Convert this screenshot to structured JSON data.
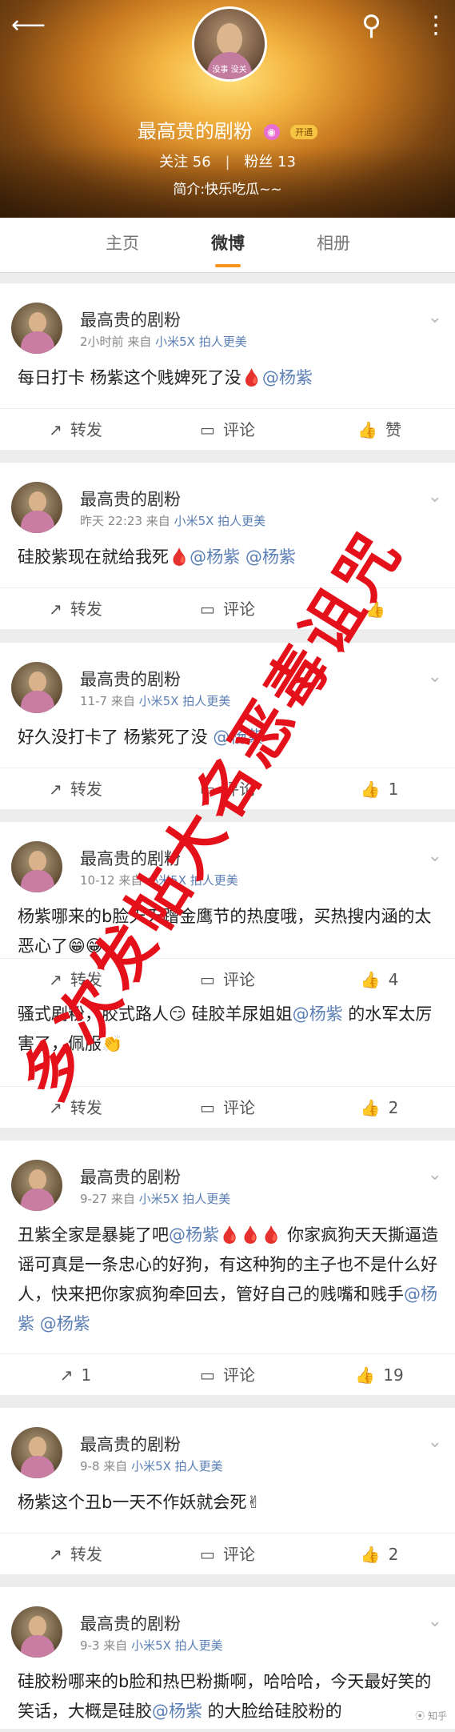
{
  "header": {
    "back_glyph": "⟵",
    "search_glyph": "⚲",
    "more_glyph": "⋮",
    "avatar_caption": "没事 没关",
    "username": "最高贵的剧粉",
    "open_badge": "开通",
    "following": "关注 56",
    "followers": "粉丝 13",
    "bio": "简介:快乐吃瓜~~"
  },
  "tabs": [
    "主页",
    "微博",
    "相册"
  ],
  "active_tab": "微博",
  "watermark": "多次发帖大名恶毒诅咒",
  "posts": [
    {
      "name": "最高贵的剧粉",
      "time": "2小时前",
      "src_prefix": "来自",
      "device": "小米5X 拍人更美",
      "text_html": "每日打卡 杨紫这个贱婢死了没🩸<span class=\"at\">@杨紫</span>",
      "repost": "转发",
      "comment": "评论",
      "like": "赞"
    },
    {
      "name": "最高贵的剧粉",
      "time": "昨天 22:23",
      "src_prefix": "来自",
      "device": "小米5X 拍人更美",
      "text_html": "硅胶紫现在就给我死🩸<span class=\"at\">@杨紫</span> <span class=\"at\">@杨紫</span>",
      "repost": "转发",
      "comment": "评论",
      "like": ""
    },
    {
      "name": "最高贵的剧粉",
      "time": "11-7",
      "src_prefix": "来自",
      "device": "小米5X 拍人更美",
      "text_html": "好久没打卡了 杨紫死了没 <span class=\"at\">@杨紫</span>",
      "repost": "转发",
      "comment": "评论",
      "like": "1"
    },
    {
      "name": "最高贵的剧粉",
      "time": "10-12",
      "src_prefix": "来自",
      "device": "小米5X 拍人更美",
      "text_html": "杨紫哪来的b脸天天蹭金鹰节的热度哦，买热搜内涵的太恶心了😁😁",
      "repost": "转发",
      "comment": "评论",
      "like": "4"
    },
    {
      "name": "",
      "time": "",
      "src_prefix": "",
      "device": "",
      "text_html": "骚式剧粉，胶式路人😏 硅胶羊尿姐姐<span class=\"at\">@杨紫</span> 的水军太厉害了，佩服👏",
      "repost": "转发",
      "comment": "评论",
      "like": "2"
    },
    {
      "name": "最高贵的剧粉",
      "time": "9-27",
      "src_prefix": "来自",
      "device": "小米5X 拍人更美",
      "text_html": "丑紫全家是暴毙了吧<span class=\"at\">@杨紫</span>🩸🩸🩸 你家疯狗天天撕逼造谣可真是一条忠心的好狗，有这种狗的主子也不是什么好人，快来把你家疯狗牵回去，管好自己的贱嘴和贱手<span class=\"at\">@杨紫</span> <span class=\"at\">@杨紫</span>",
      "repost": "1",
      "comment": "评论",
      "like": "19"
    },
    {
      "name": "最高贵的剧粉",
      "time": "9-8",
      "src_prefix": "来自",
      "device": "小米5X 拍人更美",
      "text_html": "杨紫这个丑b一天不作妖就会死✌",
      "repost": "转发",
      "comment": "评论",
      "like": "2"
    },
    {
      "name": "最高贵的剧粉",
      "time": "9-3",
      "src_prefix": "来自",
      "device": "小米5X 拍人更美",
      "text_html": "硅胶粉哪来的b脸和热巴粉撕啊，哈哈哈，今天最好笑的笑话，大概是硅胶<span class=\"at\">@杨紫</span> 的大脸给硅胶粉的",
      "repost": "",
      "comment": "",
      "like": ""
    }
  ],
  "corner_mark": "⦿ 知乎"
}
